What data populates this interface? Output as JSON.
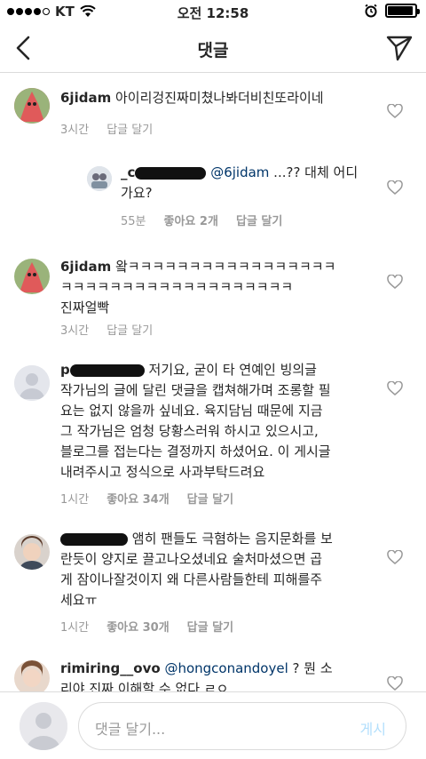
{
  "status_bar": {
    "carrier": "KT",
    "time": "오전 12:58"
  },
  "nav": {
    "title": "댓글"
  },
  "comments": [
    {
      "username": "6jidam",
      "text": "아이리겅진짜미쳤나봐더비친또라이네",
      "time": "3시간",
      "reply_label": "답글 달기",
      "likes": ""
    },
    {
      "username": "_c",
      "mention": "@6jidam",
      "text": " ...?? 대체 어디 가요?",
      "time": "55분",
      "likes": "좋아요 2개",
      "reply_label": "답글 달기"
    },
    {
      "username": "6jidam",
      "text": " 왘ㅋㅋㅋㅋㅋㅋㅋㅋㅋㅋㅋㅋㅋㅋㅋㅋㅋㅋㅋㅋㅋㅋㅋㅋㅋㅋㅋㅋㅋㅋㅋㅋㅋㅋ진짜얼빡",
      "line1": "6jidam 왘ㅋㅋㅋㅋㅋㅋㅋㅋㅋㅋㅋㅋㅋㅋㅋㅋㅋ",
      "line2": "ㅋㅋㅋㅋㅋㅋㅋㅋㅋㅋㅋㅋㅋㅋㅋㅋㅋㅋㅋ",
      "line3": "진짜얼빡",
      "time": "3시간",
      "reply_label": "답글 달기"
    },
    {
      "username": "p",
      "line1": "저기요, 굳이 타 연예인 빙의글",
      "line2": "작가님의 글에 달린 댓글을 캡쳐해가며 조롱할 필",
      "line3": "요는 없지 않을까 싶네요. 육지담님 때문에 지금",
      "line4": "그 작가님은 엄청 당황스러워 하시고 있으시고,",
      "line5": "블로그를 접는다는 결정까지 하셨어요. 이 게시글",
      "line6": "내려주시고 정식으로 사과부탁드려요",
      "time": "1시간",
      "likes": "좋아요 34개",
      "reply_label": "답글 달기"
    },
    {
      "line1": "앰히 팬들도 극혐하는 음지문화를 보",
      "line2": "란듯이 양지로 끌고나오셨네요 술처마셨으면 곱",
      "line3": "게 잠이나잘것이지 왜 다른사람들한테 피해를주",
      "line4": "세요ㅠ",
      "time": "1시간",
      "likes": "좋아요 30개",
      "reply_label": "답글 달기"
    },
    {
      "username": "rimiring__ovo",
      "mention": "@hongconandoyel",
      "line1_tail": " ? 뭔 소",
      "line2": "리야 진짜 이해할 수 없다 ㄹㅇ"
    }
  ],
  "composer": {
    "placeholder": "댓글 달기...",
    "post_label": "게시"
  },
  "colors": {
    "text": "#262626",
    "meta": "#999999",
    "mention": "#003569",
    "post_disabled": "#b2dffc",
    "divider": "#dbdbdb"
  }
}
